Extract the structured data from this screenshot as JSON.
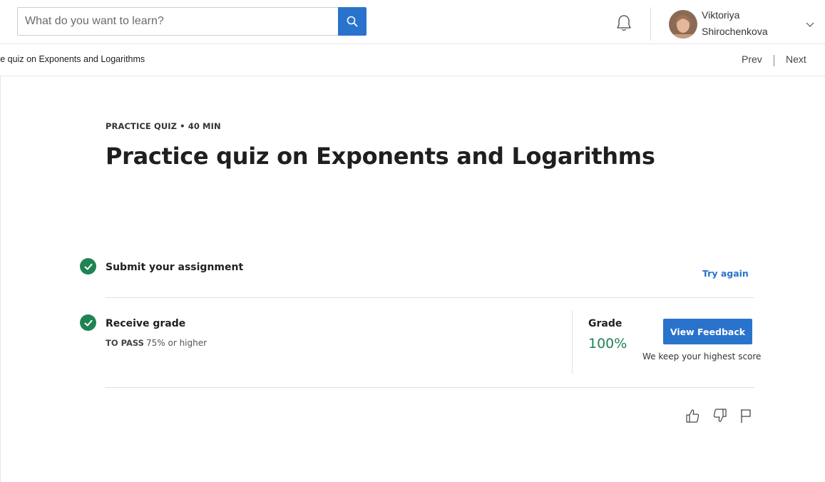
{
  "header": {
    "search": {
      "placeholder": "What do you want to learn?",
      "icon": "search-icon"
    },
    "notifications_icon": "bell-icon",
    "user": {
      "first_name": "Viktoriya",
      "last_name": "Shirochenkova",
      "menu_icon": "chevron-down-icon"
    }
  },
  "nav": {
    "breadcrumb": "ce quiz on Exponents and Logarithms",
    "prev": "Prev",
    "next": "Next"
  },
  "quiz": {
    "kicker": "PRACTICE QUIZ • 40 MIN",
    "title": "Practice quiz on Exponents and Logarithms",
    "steps": [
      {
        "title": "Submit your assignment",
        "status": "complete",
        "action": "Try again"
      },
      {
        "title": "Receive grade",
        "status": "complete",
        "pass_label": "TO PASS",
        "pass_value": "75% or higher"
      }
    ],
    "grade": {
      "label": "Grade",
      "value": "100%",
      "button": "View Feedback",
      "note": "We keep your highest score"
    }
  },
  "feedback_icons": [
    "thumbs-up-icon",
    "thumbs-down-icon",
    "flag-icon"
  ],
  "colors": {
    "accent": "#2a73cc",
    "success": "#1f8354"
  }
}
